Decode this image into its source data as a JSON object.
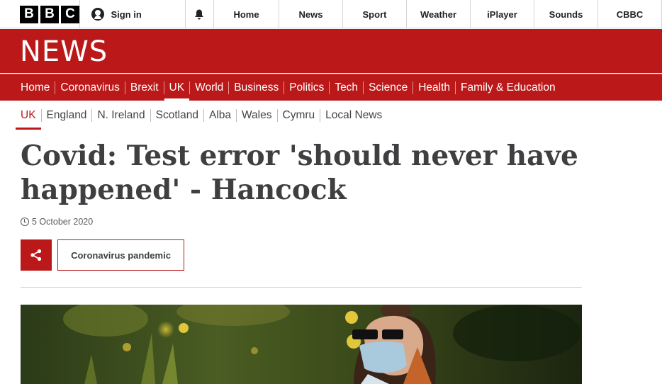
{
  "brand": {
    "letters": [
      "B",
      "B",
      "C"
    ]
  },
  "account": {
    "signin_label": "Sign in"
  },
  "top_nav": [
    "Home",
    "News",
    "Sport",
    "Weather",
    "iPlayer",
    "Sounds",
    "CBBC"
  ],
  "section": {
    "wordmark": "NEWS"
  },
  "primary_nav": {
    "items": [
      "Home",
      "Coronavirus",
      "Brexit",
      "UK",
      "World",
      "Business",
      "Politics",
      "Tech",
      "Science",
      "Health",
      "Family & Education"
    ],
    "active": "UK"
  },
  "secondary_nav": {
    "items": [
      "UK",
      "England",
      "N. Ireland",
      "Scotland",
      "Alba",
      "Wales",
      "Cymru",
      "Local News"
    ],
    "active": "UK"
  },
  "article": {
    "headline": "Covid: Test error 'should never have happened' - Hancock",
    "date": "5 October 2020",
    "tag": "Coronavirus pandemic"
  },
  "icons": {
    "bell": "bell-icon",
    "user": "user-icon",
    "clock": "clock-icon",
    "share": "share-icon"
  },
  "colors": {
    "brand_red": "#bb1919",
    "headline": "#3f3f42"
  }
}
